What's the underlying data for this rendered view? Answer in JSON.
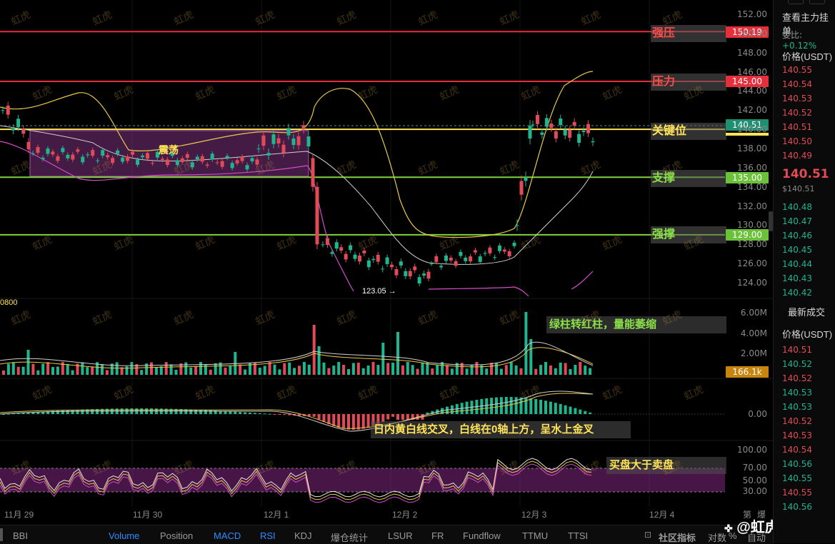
{
  "colors": {
    "up": "#e14b57",
    "down": "#1fb58f",
    "resistance": "#e52f3a",
    "key": "#ffe45a",
    "support": "#7ed33b",
    "boll_upper": "#e9c84a",
    "boll_mid": "#cfcfcf",
    "boll_lower": "#d14dc9"
  },
  "levels": [
    {
      "key": "strong_resistance",
      "label": "强压",
      "price": 150.19,
      "tag": "150.19",
      "color": "#e52f3a",
      "labelColor": "#ff5a5a"
    },
    {
      "key": "resistance",
      "label": "压力",
      "price": 145.0,
      "tag": "145.00",
      "color": "#e52f3a",
      "labelColor": "#ff5a5a"
    },
    {
      "key": "key_level",
      "label": "关键位",
      "price": 140.0,
      "tag": "",
      "color": "#ffe45a",
      "labelColor": "#ffe45a"
    },
    {
      "key": "support",
      "label": "支撑",
      "price": 135.0,
      "tag": "135.00",
      "color": "#7ed33b",
      "labelColor": "#8be04a"
    },
    {
      "key": "strong_support",
      "label": "强撑",
      "price": 129.0,
      "tag": "129.00",
      "color": "#7ed33b",
      "labelColor": "#8be04a"
    }
  ],
  "current_price_tag": "140.51",
  "volume_tag": "166.1k",
  "consolidation_label": "震荡",
  "low_marker": "123.05",
  "stray_label": "0800",
  "annotations": {
    "volume": "绿柱转红柱，量能萎缩",
    "macd": "日内黄白线交叉，白线在0轴上方，呈水上金叉",
    "rsi": "买盘大于卖盘"
  },
  "price_axis": [
    "152.00",
    "150.00",
    "148.00",
    "146.00",
    "144.00",
    "142.00",
    "140.00",
    "138.00",
    "136.00",
    "134.00",
    "132.00",
    "130.00",
    "128.00",
    "126.00",
    "124.00"
  ],
  "volume_axis": [
    "6.00M",
    "4.00M",
    "2.00M"
  ],
  "macd_axis": [
    "0.00"
  ],
  "rsi_axis": [
    "100.00",
    "70.00",
    "50.00",
    "30.00"
  ],
  "dates": [
    "11月 29",
    "11月 30",
    "12月 1",
    "12月 2",
    "12月 3",
    "12月 4"
  ],
  "bottom_tabs": [
    {
      "label": "BBI",
      "active": false
    },
    {
      "label": "Volume",
      "active": true
    },
    {
      "label": "Position",
      "active": false
    },
    {
      "label": "MACD",
      "active": true
    },
    {
      "label": "RSI",
      "active": true
    },
    {
      "label": "KDJ",
      "active": false
    },
    {
      "label": "爆仓统计",
      "active": false
    },
    {
      "label": "LSUR",
      "active": false
    },
    {
      "label": "FR",
      "active": false
    },
    {
      "label": "Fundflow",
      "active": false
    },
    {
      "label": "TTMU",
      "active": false
    },
    {
      "label": "TTSI",
      "active": false
    }
  ],
  "bottom_right": {
    "indicators": "社区指标",
    "log": "对数",
    "pct": "%",
    "auto": "自动"
  },
  "corner_labels": [
    "第",
    "爆"
  ],
  "brand": "@虹虎趋势",
  "watermark": "虹虎",
  "right_panel": {
    "title": "查看主力挂单",
    "ratio_label": "委比:",
    "ratio_value": "+0.12%",
    "price_header": "价格(USDT)",
    "asks": [
      "140.55",
      "140.54",
      "140.53",
      "140.52",
      "140.51",
      "140.50",
      "140.49"
    ],
    "last_price": "140.51",
    "last_price_sub": "$140.51",
    "bids": [
      "140.48",
      "140.47",
      "140.46",
      "140.45",
      "140.44",
      "140.43",
      "140.42"
    ],
    "trades_title": "最新成交",
    "trades_header": "价格(USDT)",
    "trades": [
      {
        "price": "140.51",
        "side": "up"
      },
      {
        "price": "140.52",
        "side": "down"
      },
      {
        "price": "140.52",
        "side": "up"
      },
      {
        "price": "140.53",
        "side": "down"
      },
      {
        "price": "140.53",
        "side": "down"
      },
      {
        "price": "140.52",
        "side": "up"
      },
      {
        "price": "140.53",
        "side": "up"
      },
      {
        "price": "140.54",
        "side": "up"
      },
      {
        "price": "140.56",
        "side": "down"
      },
      {
        "price": "140.55",
        "side": "down"
      },
      {
        "price": "140.55",
        "side": "up"
      },
      {
        "price": "140.56",
        "side": "down"
      }
    ]
  }
}
